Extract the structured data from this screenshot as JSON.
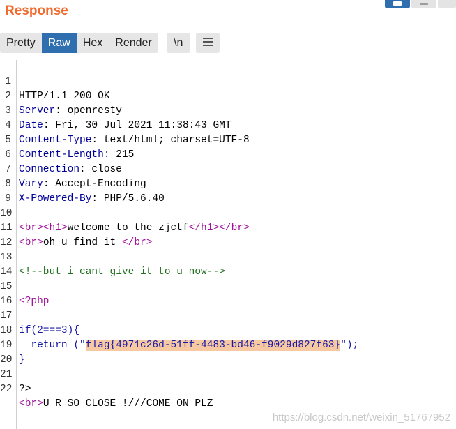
{
  "panel": {
    "title": "Response"
  },
  "tabs": [
    {
      "label": "Pretty",
      "active": false
    },
    {
      "label": "Raw",
      "active": true
    },
    {
      "label": "Hex",
      "active": false
    },
    {
      "label": "Render",
      "active": false
    }
  ],
  "newline_toggle": {
    "label": "\\n"
  },
  "menu_button": {
    "icon": "hamburger-menu-icon"
  },
  "headers": {
    "status": "HTTP/1.1 200 OK",
    "server": {
      "name": "Server",
      "value": " openresty"
    },
    "date": {
      "name": "Date",
      "value": " Fri, 30 Jul 2021 11:38:43 GMT"
    },
    "content_type": {
      "name": "Content-Type",
      "value": " text/html; charset=UTF-8"
    },
    "content_length": {
      "name": "Content-Length",
      "value": " 215"
    },
    "connection": {
      "name": "Connection",
      "value": " close"
    },
    "vary": {
      "name": "Vary",
      "value": " Accept-Encoding"
    },
    "powered_by": {
      "name": "X-Powered-By",
      "value": " PHP/5.6.40"
    }
  },
  "body": {
    "line10": {
      "t1": "<br>",
      "t2": "<h1>",
      "text": "welcome to the zjctf",
      "t3": "</h1>",
      "t4": "</br>"
    },
    "line11": {
      "t1": "<br>",
      "text": "oh u find it ",
      "t2": "</br>"
    },
    "line13": {
      "comment": "<!--but i cant give it to u now-->"
    },
    "line15": {
      "php_open": "<?php"
    },
    "line17": {
      "code": "if(2===3){"
    },
    "line18": {
      "pre": "  return (\"",
      "flag": "flag{4971c26d-51ff-4483-bd46-f9029d827f63}",
      "post": "\");"
    },
    "line19": {
      "code": "}"
    },
    "line21": {
      "php_close": "?>"
    },
    "line22": {
      "tag": "<br>",
      "text": "U R SO CLOSE !///COME ON PLZ"
    }
  },
  "line_numbers": [
    "1",
    "2",
    "3",
    "4",
    "5",
    "6",
    "7",
    "8",
    "9",
    "10",
    "11",
    "12",
    "13",
    "14",
    "15",
    "16",
    "17",
    "18",
    "19",
    "20",
    "21",
    "22"
  ],
  "watermark": "https://blog.csdn.net/weixin_51767952",
  "colors": {
    "accent": "#f26b2e",
    "active_tab": "#2f6fb0",
    "header_name": "#000099",
    "tag": "#a0119b",
    "comment": "#207020",
    "highlight": "#f7c9a2"
  }
}
